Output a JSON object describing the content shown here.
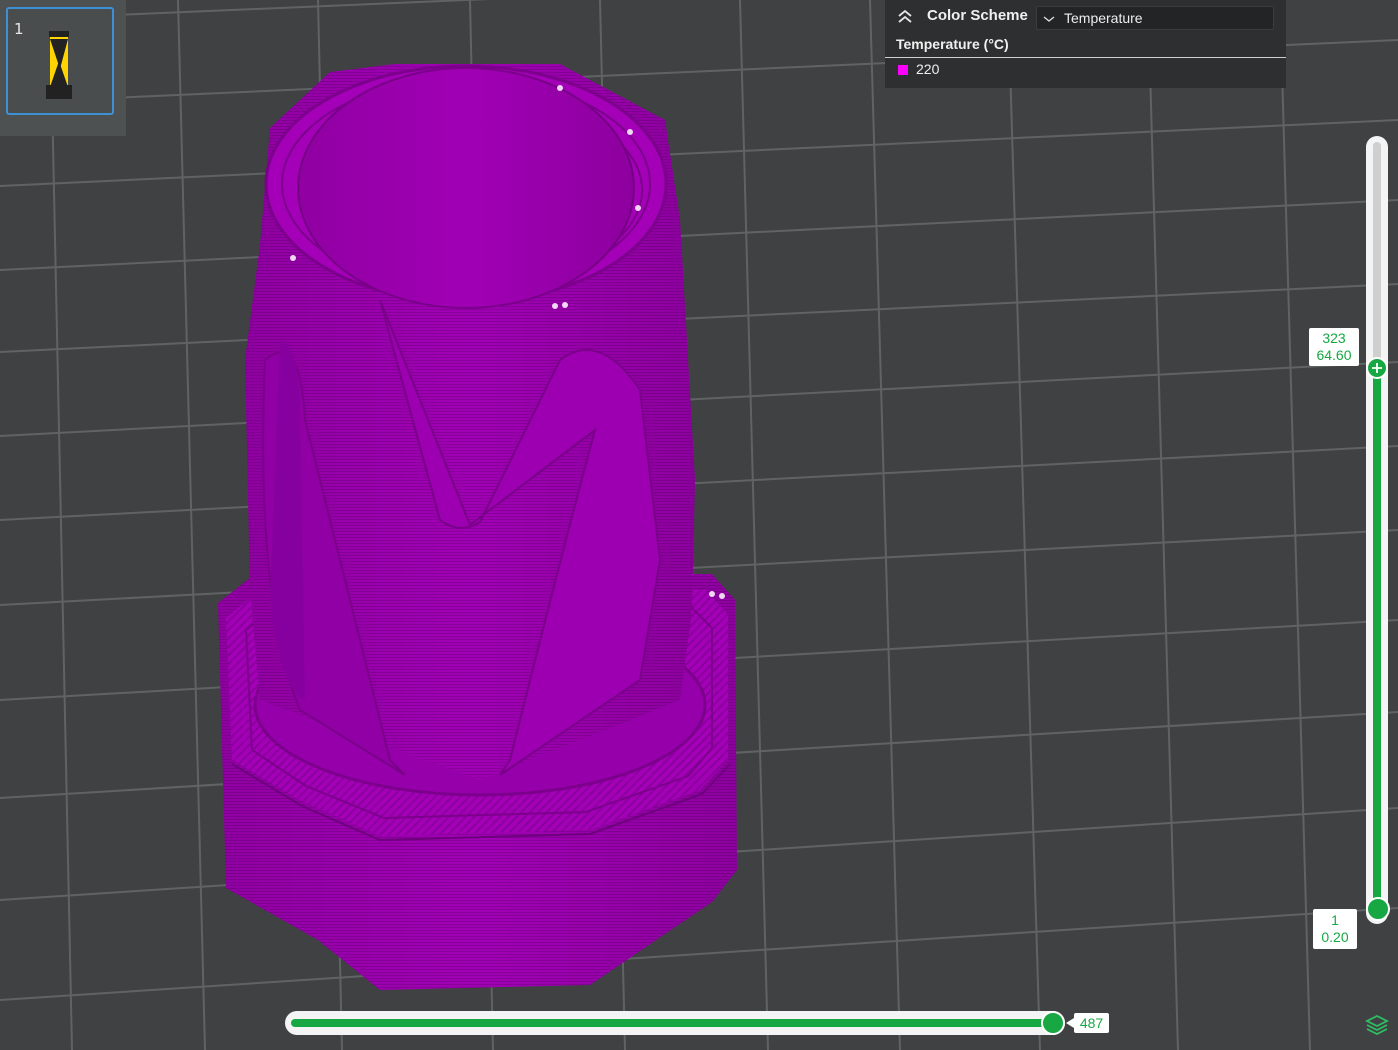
{
  "plate": {
    "index": "1"
  },
  "legend": {
    "title": "Color Scheme",
    "scheme_selected": "Temperature",
    "subtitle": "Temperature (°C)",
    "items": [
      {
        "label": "220",
        "color": "#ff00ff"
      }
    ],
    "icons": {
      "collapse": "double-chevron-up-icon",
      "dropdown": "chevron-down-icon"
    }
  },
  "layer_slider": {
    "upper_layer": "323",
    "upper_height": "64.60",
    "lower_layer": "1",
    "lower_height": "0.20",
    "accent_color": "#17a844"
  },
  "move_slider": {
    "value": "487"
  },
  "view": {
    "background_color": "#3f4142",
    "grid_color": "#5f6263",
    "model_color": "#a000b4"
  }
}
